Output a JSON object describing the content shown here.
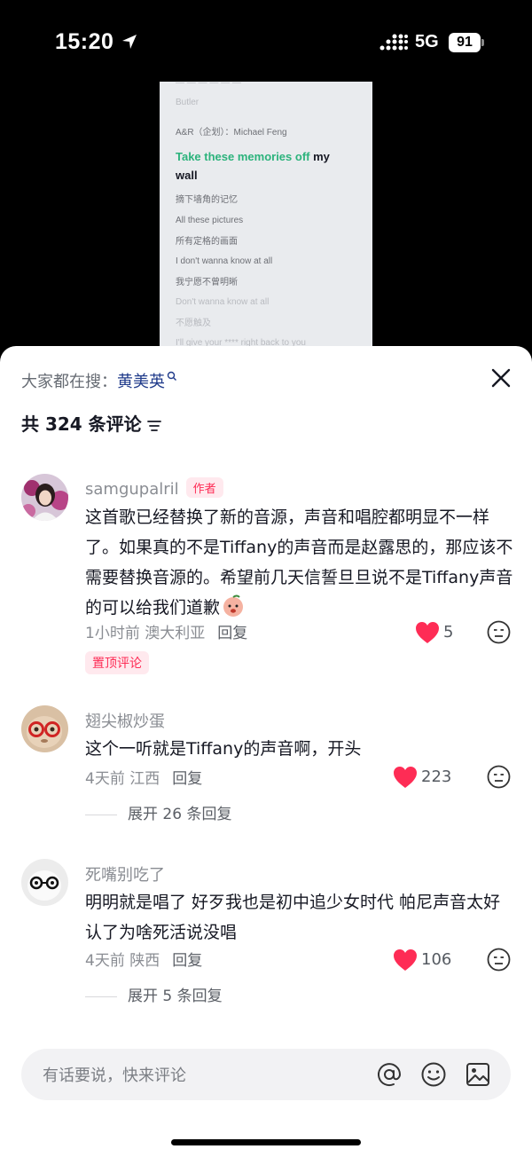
{
  "status_bar": {
    "time": "15:20",
    "network": "5G",
    "battery": "91"
  },
  "lyrics_preview": {
    "lines": [
      "Butler",
      "A&R（企划）：Michael Feng",
      "摘下墙角的记忆",
      "All these pictures",
      "所有定格的画面",
      "I don't wanna know at all",
      "我宁愿不曾明晰",
      "Don't wanna know at all",
      "不愿触及",
      "I'll give your **** right back to you"
    ],
    "highlight_green": "Take these memories off",
    "highlight_rest": " my wall"
  },
  "search_hint": {
    "prefix": "大家都在搜：",
    "keyword": "黄美英"
  },
  "comment_count_label": "共 324 条评论",
  "comments": [
    {
      "user": "samgupalril",
      "badge": "作者",
      "text": "这首歌已经替换了新的音源，声音和唱腔都明显不一样了。如果真的不是Tiffany的声音而是赵露思的，那应该不需要替换音源的。希望前几天信誓旦旦说不是Tiffany声音的可以给我们道歉",
      "time": "1小时前",
      "location": "澳大利亚",
      "reply_label": "回复",
      "likes": "5",
      "liked": true,
      "pinned_label": "置顶评论"
    },
    {
      "user": "翅尖椒炒蛋",
      "text": "这个一听就是Tiffany的声音啊，开头",
      "time": "4天前",
      "location": "江西",
      "reply_label": "回复",
      "likes": "223",
      "liked": true,
      "expand_label": "展开 26 条回复"
    },
    {
      "user": "死嘴别吃了",
      "text": "明明就是唱了 好歹我也是初中追少女时代 帕尼声音太好认了为啥死活说没唱",
      "time": "4天前",
      "location": "陕西",
      "reply_label": "回复",
      "likes": "106",
      "liked": true,
      "expand_label": "展开 5 条回复"
    }
  ],
  "input_bar": {
    "placeholder": "有话要说，快来评论"
  },
  "colors": {
    "like_red": "#fe2c55",
    "accent_green": "#2cb37c",
    "keyword_blue": "#1f3a8a"
  },
  "icons": [
    "location-arrow-icon",
    "signal-icon",
    "close-icon",
    "filter-icon",
    "heart-icon",
    "emoji-reaction-icon",
    "at-icon",
    "emoji-icon",
    "image-icon",
    "search-mini-icon",
    "peach-emoji-icon"
  ]
}
